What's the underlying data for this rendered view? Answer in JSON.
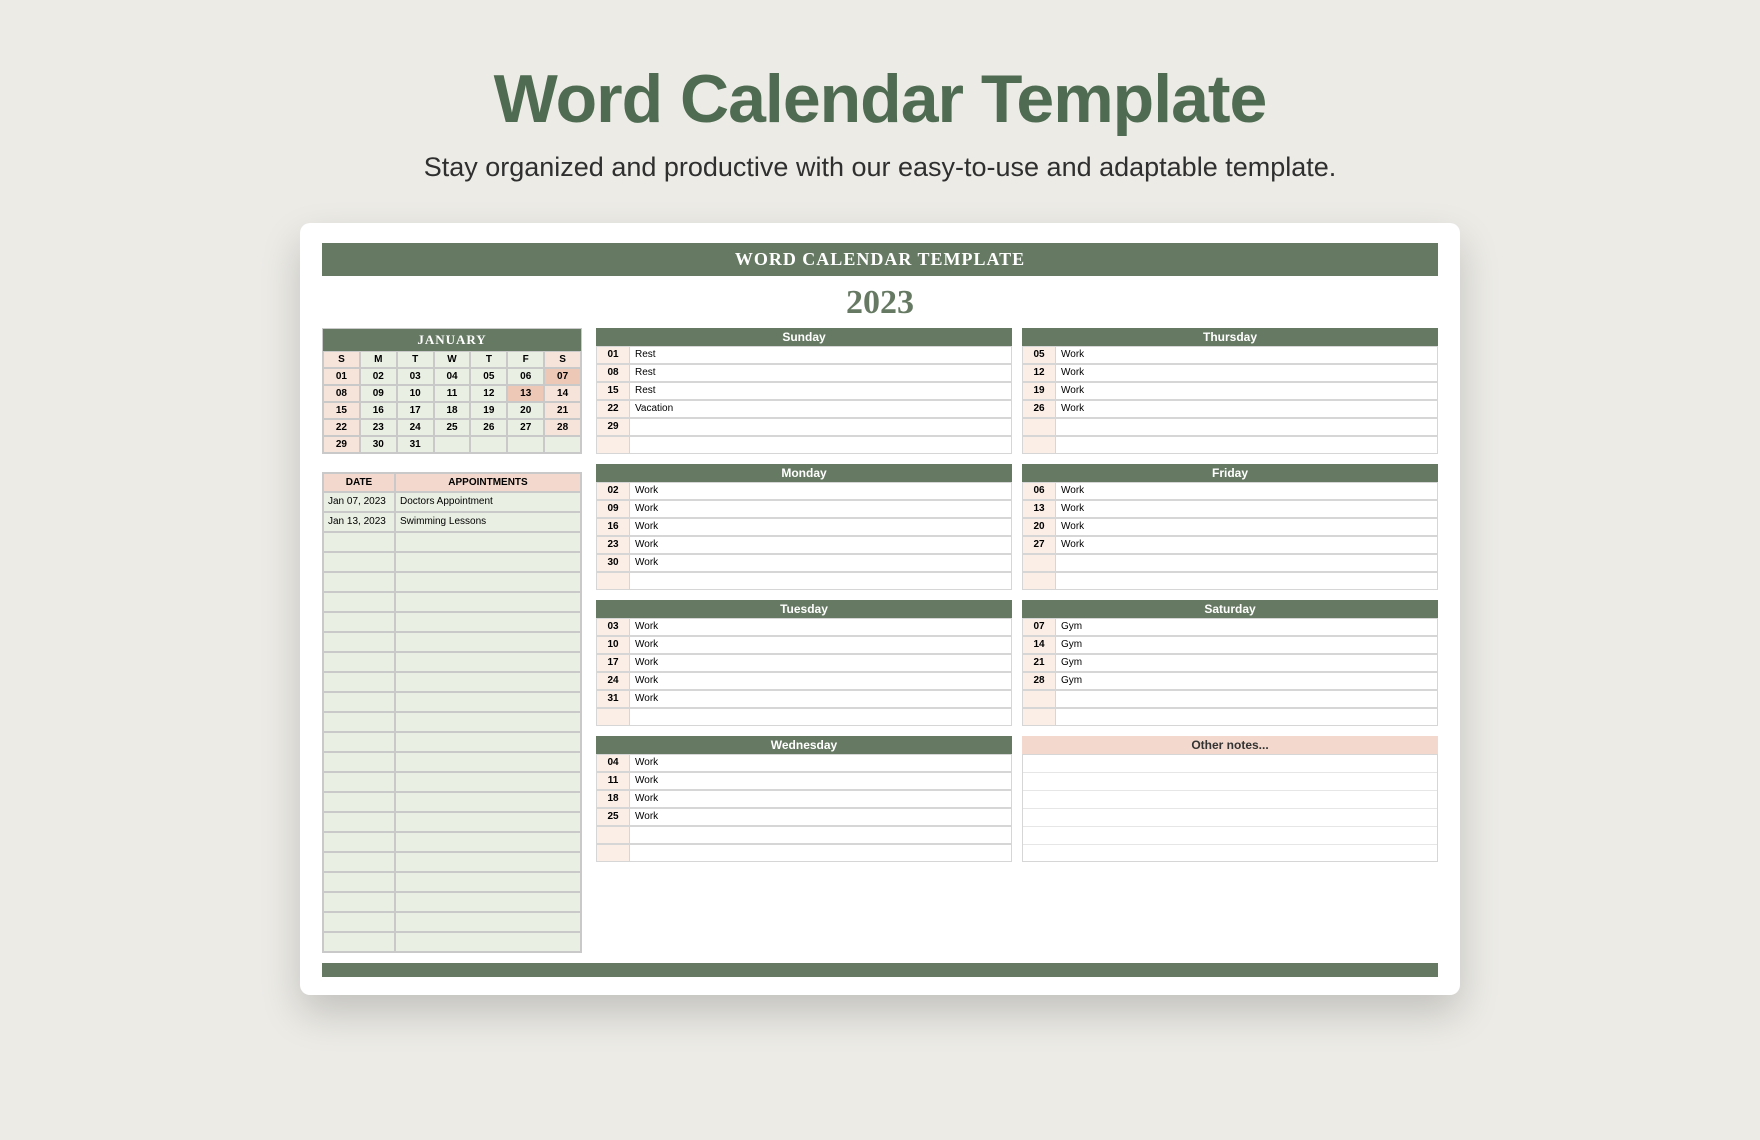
{
  "hero": {
    "title": "Word Calendar Template",
    "subtitle": "Stay organized and productive with our easy-to-use and adaptable template."
  },
  "card": {
    "banner": "WORD CALENDAR TEMPLATE",
    "year": "2023"
  },
  "mini": {
    "month": "JANUARY",
    "dow": [
      "S",
      "M",
      "T",
      "W",
      "T",
      "F",
      "S"
    ],
    "rows": [
      [
        "01",
        "02",
        "03",
        "04",
        "05",
        "06",
        "07"
      ],
      [
        "08",
        "09",
        "10",
        "11",
        "12",
        "13",
        "14"
      ],
      [
        "15",
        "16",
        "17",
        "18",
        "19",
        "20",
        "21"
      ],
      [
        "22",
        "23",
        "24",
        "25",
        "26",
        "27",
        "28"
      ],
      [
        "29",
        "30",
        "31",
        "",
        "",
        "",
        ""
      ]
    ],
    "highlight": [
      "07",
      "13"
    ]
  },
  "appt": {
    "head_date": "DATE",
    "head_text": "APPOINTMENTS",
    "rows": [
      {
        "date": "Jan 07, 2023",
        "text": "Doctors Appointment"
      },
      {
        "date": "Jan 13, 2023",
        "text": "Swimming Lessons"
      },
      {
        "date": "",
        "text": ""
      },
      {
        "date": "",
        "text": ""
      },
      {
        "date": "",
        "text": ""
      },
      {
        "date": "",
        "text": ""
      },
      {
        "date": "",
        "text": ""
      },
      {
        "date": "",
        "text": ""
      },
      {
        "date": "",
        "text": ""
      },
      {
        "date": "",
        "text": ""
      },
      {
        "date": "",
        "text": ""
      },
      {
        "date": "",
        "text": ""
      },
      {
        "date": "",
        "text": ""
      },
      {
        "date": "",
        "text": ""
      },
      {
        "date": "",
        "text": ""
      },
      {
        "date": "",
        "text": ""
      },
      {
        "date": "",
        "text": ""
      },
      {
        "date": "",
        "text": ""
      },
      {
        "date": "",
        "text": ""
      },
      {
        "date": "",
        "text": ""
      },
      {
        "date": "",
        "text": ""
      },
      {
        "date": "",
        "text": ""
      },
      {
        "date": "",
        "text": ""
      }
    ]
  },
  "blocks": {
    "sunday": {
      "title": "Sunday",
      "rows": [
        [
          "01",
          "Rest"
        ],
        [
          "08",
          "Rest"
        ],
        [
          "15",
          "Rest"
        ],
        [
          "22",
          "Vacation"
        ],
        [
          "29",
          ""
        ],
        [
          "",
          ""
        ]
      ]
    },
    "thursday": {
      "title": "Thursday",
      "rows": [
        [
          "05",
          "Work"
        ],
        [
          "12",
          "Work"
        ],
        [
          "19",
          "Work"
        ],
        [
          "26",
          "Work"
        ],
        [
          "",
          ""
        ],
        [
          "",
          ""
        ]
      ]
    },
    "monday": {
      "title": "Monday",
      "rows": [
        [
          "02",
          "Work"
        ],
        [
          "09",
          "Work"
        ],
        [
          "16",
          "Work"
        ],
        [
          "23",
          "Work"
        ],
        [
          "30",
          "Work"
        ],
        [
          "",
          ""
        ]
      ]
    },
    "friday": {
      "title": "Friday",
      "rows": [
        [
          "06",
          "Work"
        ],
        [
          "13",
          "Work"
        ],
        [
          "20",
          "Work"
        ],
        [
          "27",
          "Work"
        ],
        [
          "",
          ""
        ],
        [
          "",
          ""
        ]
      ]
    },
    "tuesday": {
      "title": "Tuesday",
      "rows": [
        [
          "03",
          "Work"
        ],
        [
          "10",
          "Work"
        ],
        [
          "17",
          "Work"
        ],
        [
          "24",
          "Work"
        ],
        [
          "31",
          "Work"
        ],
        [
          "",
          ""
        ]
      ]
    },
    "saturday": {
      "title": "Saturday",
      "rows": [
        [
          "07",
          "Gym"
        ],
        [
          "14",
          "Gym"
        ],
        [
          "21",
          "Gym"
        ],
        [
          "28",
          "Gym"
        ],
        [
          "",
          ""
        ],
        [
          "",
          ""
        ]
      ]
    },
    "wednesday": {
      "title": "Wednesday",
      "rows": [
        [
          "04",
          "Work"
        ],
        [
          "11",
          "Work"
        ],
        [
          "18",
          "Work"
        ],
        [
          "25",
          "Work"
        ],
        [
          "",
          ""
        ],
        [
          "",
          ""
        ]
      ]
    },
    "notes": {
      "title": "Other notes..."
    }
  }
}
